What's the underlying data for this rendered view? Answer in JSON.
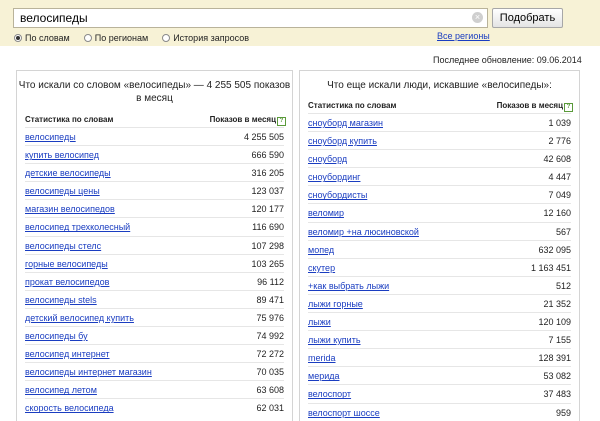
{
  "search": {
    "query": "велосипеды",
    "button_label": "Подобрать",
    "clear_symbol": "×"
  },
  "modes": [
    {
      "label": "По словам",
      "selected": true
    },
    {
      "label": "По регионам",
      "selected": false
    },
    {
      "label": "История запросов",
      "selected": false
    }
  ],
  "regions_link": "Все регионы",
  "last_update": "Последнее обновление: 09.06.2014",
  "left_panel": {
    "title": "Что искали со словом «велосипеды» — 4 255 505 показов в месяц",
    "col_phrase": "Статистика по словам",
    "col_count": "Показов в месяц",
    "help": "?",
    "rows": [
      {
        "phrase": "велосипеды",
        "count": "4 255 505"
      },
      {
        "phrase": "купить велосипед",
        "count": "666 590"
      },
      {
        "phrase": "детские велосипеды",
        "count": "316 205"
      },
      {
        "phrase": "велосипеды цены",
        "count": "123 037"
      },
      {
        "phrase": "магазин велосипедов",
        "count": "120 177"
      },
      {
        "phrase": "велосипед трехколесный",
        "count": "116 690"
      },
      {
        "phrase": "велосипеды стелс",
        "count": "107 298"
      },
      {
        "phrase": "горные велосипеды",
        "count": "103 265"
      },
      {
        "phrase": "прокат велосипедов",
        "count": "96 112"
      },
      {
        "phrase": "велосипеды stels",
        "count": "89 471"
      },
      {
        "phrase": "детский велосипед купить",
        "count": "75 976"
      },
      {
        "phrase": "велосипеды бу",
        "count": "74 992"
      },
      {
        "phrase": "велосипед интернет",
        "count": "72 272"
      },
      {
        "phrase": "велосипеды интернет магазин",
        "count": "70 035"
      },
      {
        "phrase": "велосипед летом",
        "count": "63 608"
      },
      {
        "phrase": "скорость велосипеда",
        "count": "62 031"
      }
    ]
  },
  "right_panel": {
    "title": "Что еще искали люди, искавшие «велосипеды»:",
    "col_phrase": "Статистика по словам",
    "col_count": "Показов в месяц",
    "help": "?",
    "rows": [
      {
        "phrase": "сноуборд магазин",
        "count": "1 039"
      },
      {
        "phrase": "сноуборд купить",
        "count": "2 776"
      },
      {
        "phrase": "сноуборд",
        "count": "42 608"
      },
      {
        "phrase": "сноубординг",
        "count": "4 447"
      },
      {
        "phrase": "сноубордисты",
        "count": "7 049"
      },
      {
        "phrase": "веломир",
        "count": "12 160"
      },
      {
        "phrase": "веломир +на люсиновской",
        "count": "567"
      },
      {
        "phrase": "мопед",
        "count": "632 095"
      },
      {
        "phrase": "скутер",
        "count": "1 163 451"
      },
      {
        "phrase": "+как выбрать лыжи",
        "count": "512"
      },
      {
        "phrase": "лыжи горные",
        "count": "21 352"
      },
      {
        "phrase": "лыжи",
        "count": "120 109"
      },
      {
        "phrase": "лыжи купить",
        "count": "7 155"
      },
      {
        "phrase": "merida",
        "count": "128 391"
      },
      {
        "phrase": "мерида",
        "count": "53 082"
      },
      {
        "phrase": "велоспорт",
        "count": "37 483"
      },
      {
        "phrase": "велоспорт шоссе",
        "count": "959"
      }
    ]
  },
  "colors": {
    "topbar_bg": "#f7f2d6",
    "link": "#1a3dc1",
    "text": "#222222",
    "border": "#d4d4d4"
  }
}
